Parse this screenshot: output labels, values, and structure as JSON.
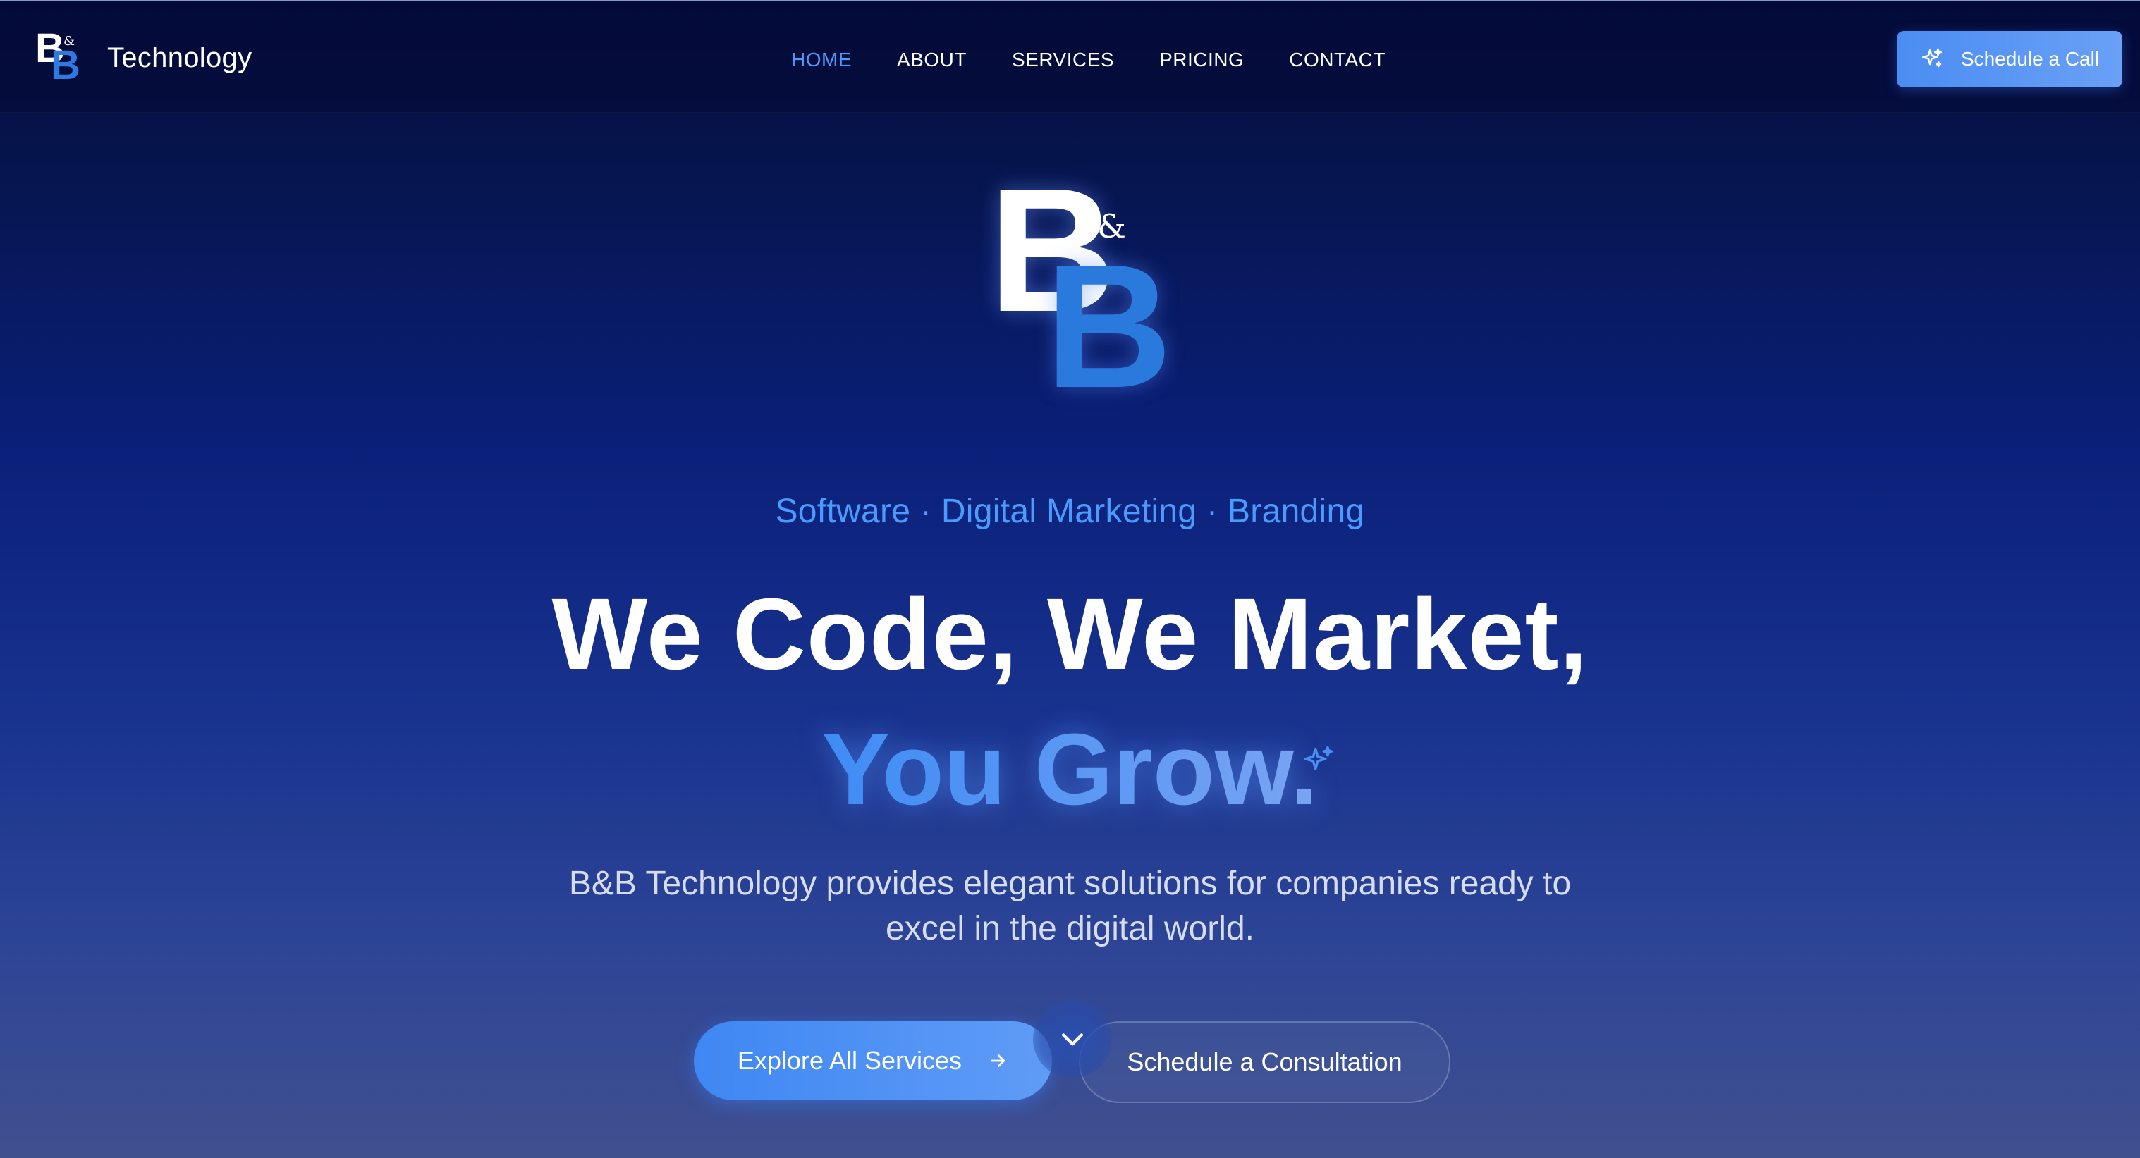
{
  "brand": {
    "mark_b1": "B",
    "mark_amp": "&",
    "mark_b2": "B",
    "name": "Technology"
  },
  "nav": {
    "items": [
      {
        "label": "HOME",
        "active": true
      },
      {
        "label": "ABOUT",
        "active": false
      },
      {
        "label": "SERVICES",
        "active": false
      },
      {
        "label": "PRICING",
        "active": false
      },
      {
        "label": "CONTACT",
        "active": false
      }
    ]
  },
  "header_cta": {
    "label": "Schedule a Call",
    "icon": "sparkle-icon"
  },
  "hero": {
    "logo_b1": "B",
    "logo_amp": "&",
    "logo_b2": "B",
    "tagline": "Software · Digital Marketing · Branding",
    "headline_line1": "We Code, We Market,",
    "headline_line2": "You Grow.",
    "description": "B&B Technology provides elegant solutions for companies ready to excel in the digital world.",
    "primary_button": "Explore All Services",
    "secondary_button": "Schedule a Consultation",
    "scroll_icon": "chevron-down-icon"
  },
  "colors": {
    "accent": "#4b9bff",
    "brand_blue": "#2a79dd",
    "background_top": "#040d3d",
    "background_bottom": "#40508f"
  }
}
